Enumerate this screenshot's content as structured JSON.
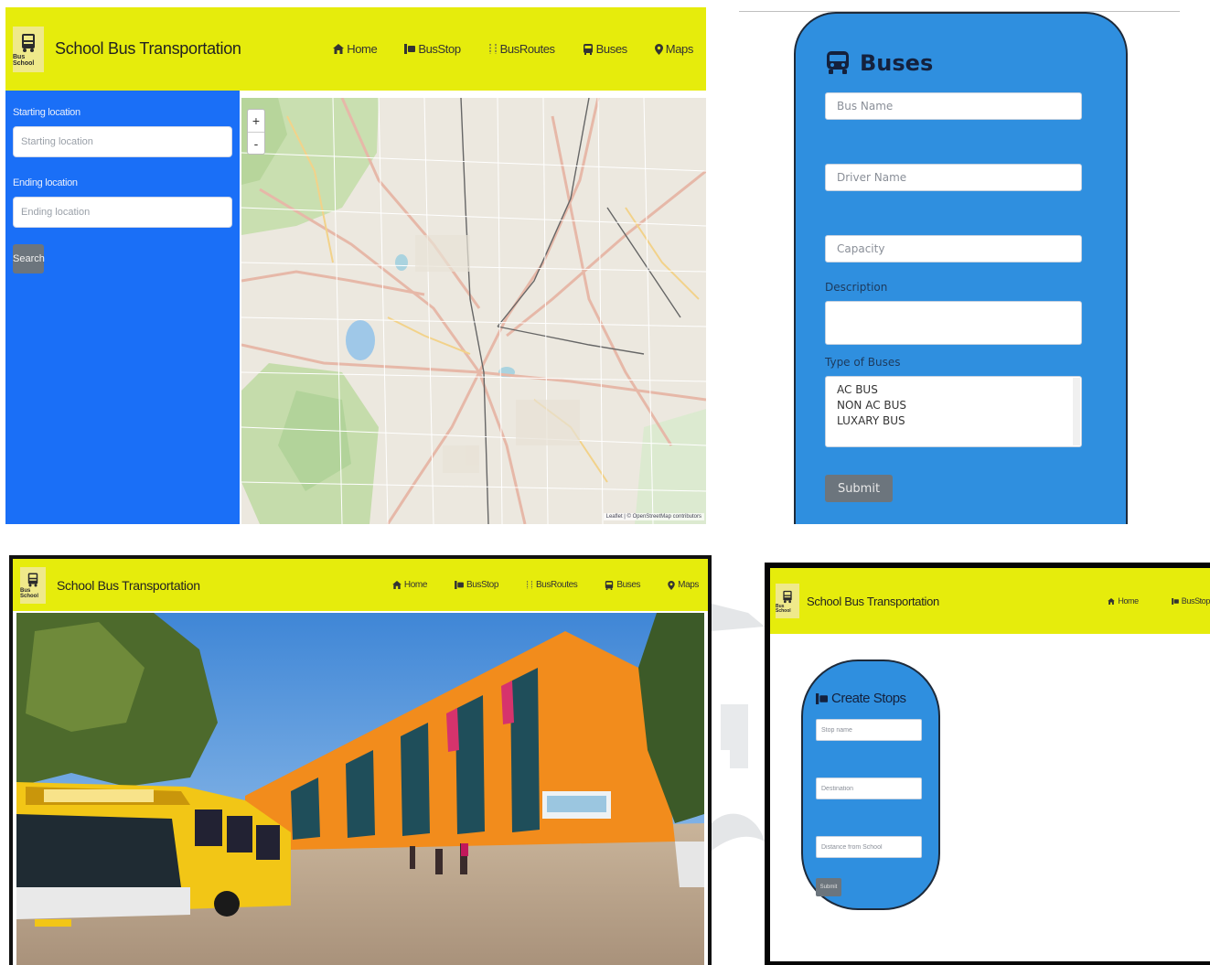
{
  "app": {
    "brand_title": "School Bus Transportation",
    "logo_text": "Bus School"
  },
  "nav": {
    "home": "Home",
    "busstop": "BusStop",
    "busroutes": "BusRoutes",
    "buses": "Buses",
    "maps": "Maps"
  },
  "icons": {
    "home": "home-icon",
    "busstop": "busstop-icon",
    "busroutes": "route-icon",
    "buses": "bus-icon",
    "maps": "map-marker-icon",
    "logo": "school-bus-icon"
  },
  "colors": {
    "navbar": "#e6ec0c",
    "sidebar": "#1a6ff7",
    "form_card": "#2f8fdf",
    "button": "#6c757d"
  },
  "route_search": {
    "start_label": "Starting location",
    "start_placeholder": "Starting location",
    "end_label": "Ending location",
    "end_placeholder": "Ending location",
    "search_button": "Search"
  },
  "map": {
    "zoom_in": "+",
    "zoom_out": "-",
    "attribution": "Leaflet | © OpenStreetMap contributors"
  },
  "buses_form": {
    "title": "Buses",
    "bus_name_placeholder": "Bus Name",
    "driver_name_placeholder": "Driver Name",
    "capacity_placeholder": "Capacity",
    "description_label": "Description",
    "type_label": "Type of Buses",
    "types": [
      "AC BUS",
      "NON AC BUS",
      "LUXARY BUS"
    ],
    "submit": "Submit"
  },
  "stops_form": {
    "title": "Create Stops",
    "stop_name_placeholder": "Stop name",
    "destination_placeholder": "Destination",
    "distance_placeholder": "Distance from School",
    "submit": "Submit"
  }
}
